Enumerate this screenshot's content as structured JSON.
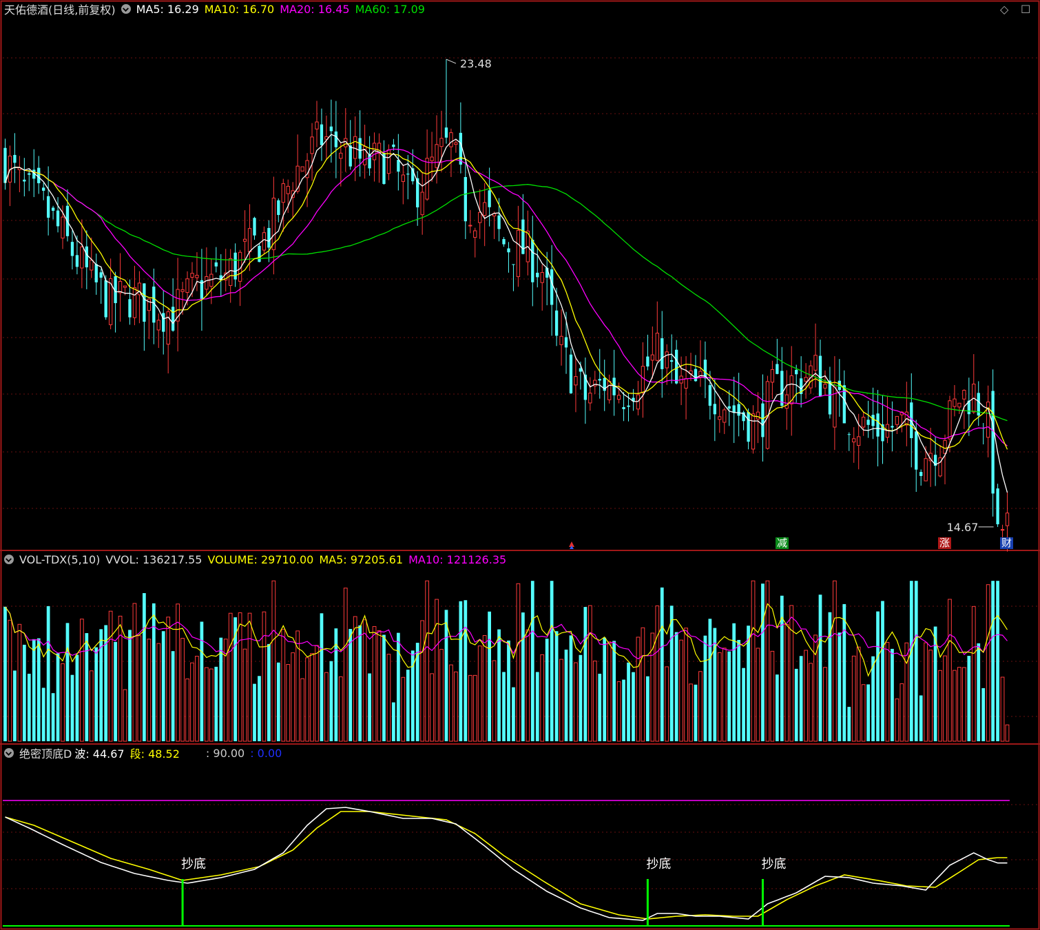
{
  "main_header": {
    "title": "天佑德酒(日线,前复权)",
    "ma5": "MA5: 16.29",
    "ma10": "MA10: 16.70",
    "ma20": "MA20: 16.45",
    "ma60": "MA60: 17.09"
  },
  "vol_header": {
    "name": "VOL-TDX(5,10)",
    "vvol": "VVOL: 136217.55",
    "volume": "VOLUME: 29710.00",
    "ma5": "MA5: 97205.61",
    "ma10": "MA10: 121126.35"
  },
  "osc_header": {
    "name": "绝密顶底D",
    "bo": "波: 44.67",
    "duan": "段: 48.52",
    "level": ": 90.00",
    "zero": ": 0.00"
  },
  "corner_icons": {
    "diamond": "◇",
    "box": "☐"
  },
  "markers": {
    "jian": "减",
    "zhang": "涨",
    "cai": "财"
  },
  "signals": [
    {
      "label": "抄底",
      "day": 37
    },
    {
      "label": "抄底",
      "day": 134
    },
    {
      "label": "抄底",
      "day": 158
    }
  ],
  "colors": {
    "up": "#ff3b3b",
    "down": "#54ffff",
    "ma5": "#ffffff",
    "ma10": "#ffff00",
    "ma20": "#ff00ff",
    "ma60": "#00e000",
    "osc_bo": "#ffffff",
    "osc_duan": "#ffff00",
    "osc_level": "#ff00ff",
    "signal": "#00ff00"
  },
  "chart_data": [
    {
      "type": "candlestick",
      "title": "天佑德酒(日线,前复权)",
      "price_range": [
        14.5,
        24.0
      ],
      "days": 210,
      "high_label": "23.48",
      "low_label": "14.67",
      "high_price": 23.48,
      "low_price": 14.67,
      "high_day": 92,
      "low_day": 207,
      "series": [
        {
          "name": "MA5",
          "last": 16.29
        },
        {
          "name": "MA10",
          "last": 16.7
        },
        {
          "name": "MA20",
          "last": 16.45
        },
        {
          "name": "MA60",
          "last": 17.09
        }
      ],
      "close_path": [
        [
          0,
          21.6
        ],
        [
          4,
          21.0
        ],
        [
          8,
          20.7
        ],
        [
          13,
          20.0
        ],
        [
          18,
          19.3
        ],
        [
          22,
          18.9
        ],
        [
          26,
          19.0
        ],
        [
          31,
          18.8
        ],
        [
          35,
          18.7
        ],
        [
          40,
          19.2
        ],
        [
          46,
          19.4
        ],
        [
          50,
          19.8
        ],
        [
          55,
          20.2
        ],
        [
          60,
          21.3
        ],
        [
          66,
          22.0
        ],
        [
          71,
          21.8
        ],
        [
          75,
          21.5
        ],
        [
          80,
          21.6
        ],
        [
          84,
          20.9
        ],
        [
          87,
          21.2
        ],
        [
          90,
          21.6
        ],
        [
          93,
          21.9
        ],
        [
          96,
          20.7
        ],
        [
          100,
          20.6
        ],
        [
          104,
          20.0
        ],
        [
          108,
          19.9
        ],
        [
          112,
          19.5
        ],
        [
          115,
          18.1
        ],
        [
          118,
          17.6
        ],
        [
          121,
          17.1
        ],
        [
          125,
          17.4
        ],
        [
          129,
          17.2
        ],
        [
          133,
          17.6
        ],
        [
          137,
          18.0
        ],
        [
          140,
          17.3
        ],
        [
          144,
          17.3
        ],
        [
          148,
          17.2
        ],
        [
          153,
          16.8
        ],
        [
          157,
          16.6
        ],
        [
          160,
          17.2
        ],
        [
          164,
          17.4
        ],
        [
          169,
          17.6
        ],
        [
          174,
          16.9
        ],
        [
          178,
          16.6
        ],
        [
          182,
          16.5
        ],
        [
          187,
          16.6
        ],
        [
          191,
          16.0
        ],
        [
          195,
          16.3
        ],
        [
          199,
          17.1
        ],
        [
          202,
          17.2
        ],
        [
          205,
          16.6
        ],
        [
          207,
          14.67
        ]
      ]
    },
    {
      "type": "bar",
      "title": "VOL-TDX(5,10)",
      "series": [
        {
          "name": "VOLUME",
          "last": 29710.0
        },
        {
          "name": "MA5",
          "last": 97205.61
        },
        {
          "name": "MA10",
          "last": 121126.35
        },
        {
          "name": "VVOL",
          "last": 136217.55
        }
      ],
      "ylim": [
        0,
        300000
      ]
    },
    {
      "type": "line",
      "title": "绝密顶底D",
      "ylim": [
        0,
        100
      ],
      "level": 90.0,
      "series": [
        {
          "name": "波",
          "last": 44.67,
          "path": [
            [
              0,
              78
            ],
            [
              5,
              70
            ],
            [
              12,
              58
            ],
            [
              20,
              45
            ],
            [
              27,
              37
            ],
            [
              34,
              32
            ],
            [
              38,
              30
            ],
            [
              45,
              34
            ],
            [
              52,
              40
            ],
            [
              58,
              52
            ],
            [
              63,
              72
            ],
            [
              67,
              84
            ],
            [
              71,
              85
            ],
            [
              76,
              82
            ],
            [
              83,
              77
            ],
            [
              89,
              77
            ],
            [
              94,
              73
            ],
            [
              100,
              57
            ],
            [
              106,
              40
            ],
            [
              113,
              24
            ],
            [
              120,
              12
            ],
            [
              126,
              5
            ],
            [
              133,
              3
            ],
            [
              136,
              8
            ],
            [
              140,
              8
            ],
            [
              144,
              6
            ],
            [
              149,
              6
            ],
            [
              155,
              4
            ],
            [
              159,
              15
            ],
            [
              165,
              23
            ],
            [
              171,
              35
            ],
            [
              176,
              34
            ],
            [
              181,
              30
            ],
            [
              187,
              28
            ],
            [
              192,
              25
            ],
            [
              197,
              43
            ],
            [
              202,
              52
            ],
            [
              205,
              47
            ],
            [
              207,
              44.67
            ]
          ]
        },
        {
          "name": "段",
          "last": 48.52,
          "path": [
            [
              0,
              78
            ],
            [
              6,
              72
            ],
            [
              14,
              60
            ],
            [
              22,
              48
            ],
            [
              30,
              40
            ],
            [
              37,
              32
            ],
            [
              45,
              36
            ],
            [
              53,
              42
            ],
            [
              60,
              54
            ],
            [
              65,
              70
            ],
            [
              70,
              82
            ],
            [
              76,
              82
            ],
            [
              84,
              79
            ],
            [
              92,
              76
            ],
            [
              98,
              66
            ],
            [
              104,
              50
            ],
            [
              112,
              32
            ],
            [
              120,
              15
            ],
            [
              128,
              7
            ],
            [
              134,
              4
            ],
            [
              140,
              6
            ],
            [
              146,
              7
            ],
            [
              152,
              6
            ],
            [
              157,
              6
            ],
            [
              163,
              18
            ],
            [
              169,
              28
            ],
            [
              175,
              36
            ],
            [
              182,
              32
            ],
            [
              188,
              28
            ],
            [
              194,
              27
            ],
            [
              199,
              38
            ],
            [
              203,
              47
            ],
            [
              207,
              48.52
            ]
          ]
        }
      ]
    }
  ]
}
